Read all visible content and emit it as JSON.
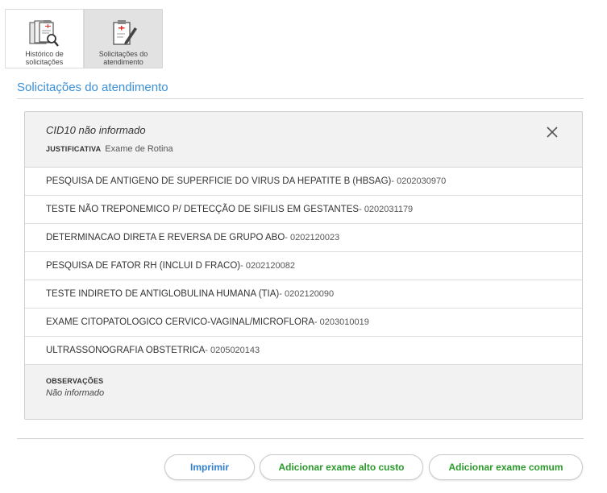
{
  "tabs": [
    {
      "label": "Histórico de\nsolicitações",
      "icon": "clipboard-search-icon"
    },
    {
      "label": "Solicitações do\natendimento",
      "icon": "clipboard-edit-icon"
    }
  ],
  "section": {
    "title": "Solicitações do atendimento"
  },
  "card": {
    "cid": "CID10 não informado",
    "justificativa_label": "JUSTIFICATIVA",
    "justificativa_value": "Exame de Rotina",
    "exams": [
      {
        "name": "PESQUISA DE ANTIGENO DE SUPERFICIE DO VIRUS DA HEPATITE B (HBSAG)",
        "code": " - 0202030970"
      },
      {
        "name": "TESTE NÃO TREPONEMICO P/ DETECÇÃO DE SIFILIS EM GESTANTES",
        "code": " - 0202031179"
      },
      {
        "name": "DETERMINACAO DIRETA E REVERSA DE GRUPO ABO",
        "code": " - 0202120023"
      },
      {
        "name": "PESQUISA DE FATOR RH (INCLUI D FRACO)",
        "code": " - 0202120082"
      },
      {
        "name": "TESTE INDIRETO DE ANTIGLOBULINA HUMANA (TIA)",
        "code": " - 0202120090"
      },
      {
        "name": "EXAME CITOPATOLOGICO CERVICO-VAGINAL/MICROFLORA",
        "code": " - 0203010019"
      },
      {
        "name": "ULTRASSONOGRAFIA OBSTETRICA",
        "code": " - 0205020143"
      }
    ],
    "observacoes_label": "OBSERVAÇÕES",
    "observacoes_value": "Não informado"
  },
  "buttons": {
    "print": "Imprimir",
    "add_alto_custo": "Adicionar exame alto custo",
    "add_comum": "Adicionar exame comum"
  },
  "colors": {
    "accent": "#3a8fd6",
    "green": "#2a9a2a",
    "active_tab": "#e2e2e2",
    "card_bg": "#f2f2f2"
  }
}
